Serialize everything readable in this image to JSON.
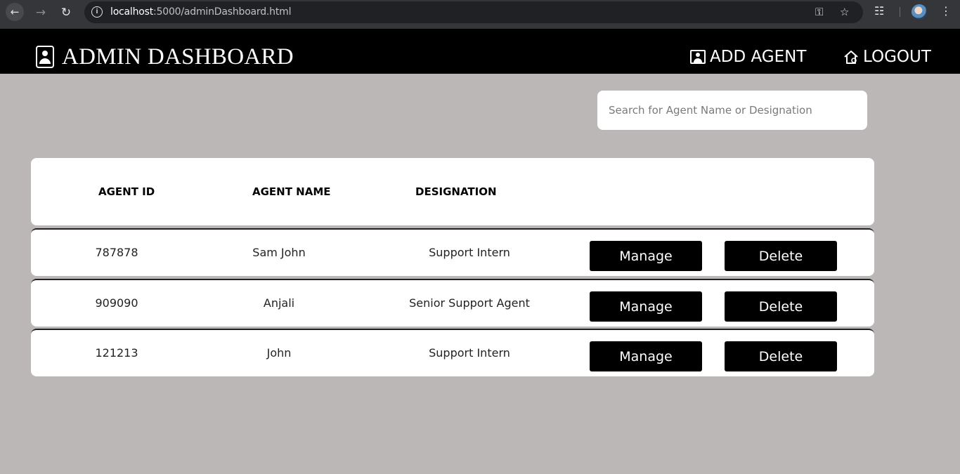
{
  "browser": {
    "url_host": "localhost",
    "url_rest": ":5000/adminDashboard.html"
  },
  "header": {
    "title": "ADMIN DASHBOARD",
    "add_agent_label": "ADD AGENT",
    "logout_label": "LOGOUT"
  },
  "search": {
    "placeholder": "Search for Agent Name or Designation",
    "value": ""
  },
  "table": {
    "columns": [
      "AGENT ID",
      "AGENT NAME",
      "DESIGNATION"
    ],
    "rows": [
      {
        "id": "787878",
        "name": "Sam John",
        "designation": "Support Intern",
        "manage_label": "Manage",
        "delete_label": "Delete"
      },
      {
        "id": "909090",
        "name": "Anjali",
        "designation": "Senior Support Agent",
        "manage_label": "Manage",
        "delete_label": "Delete"
      },
      {
        "id": "121213",
        "name": "John",
        "designation": "Support Intern",
        "manage_label": "Manage",
        "delete_label": "Delete"
      }
    ]
  },
  "colors": {
    "page_bg": "#bcb7b7",
    "header_bg": "#000000",
    "button_bg": "#000000"
  }
}
